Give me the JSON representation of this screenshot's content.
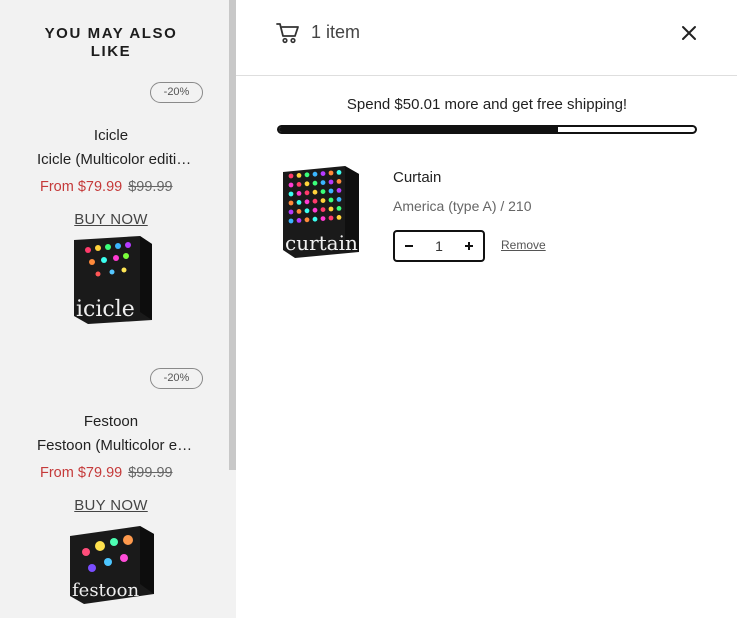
{
  "recommendations": {
    "title": "YOU MAY ALSO LIKE",
    "items": [
      {
        "badge": "-20%",
        "name": "Icicle",
        "variant": "Icicle (Multicolor edition)",
        "price_sale": "From $79.99",
        "price_old": "$99.99",
        "cta": "BUY NOW",
        "image_word": "icicle"
      },
      {
        "badge": "-20%",
        "name": "Festoon",
        "variant": "Festoon (Multicolor edition)",
        "price_sale": "From $79.99",
        "price_old": "$99.99",
        "cta": "BUY NOW",
        "image_word": "festoon"
      }
    ]
  },
  "cart": {
    "header_icon": "cart-icon",
    "item_count": "1 item",
    "close_icon": "close-icon",
    "shipping_message": "Spend $50.01 more and get free shipping!",
    "shipping_progress": 0.67,
    "line_items": [
      {
        "title": "Curtain",
        "variant": "America (type A) / 210",
        "quantity": "1",
        "remove_label": "Remove",
        "image_word": "curtain"
      }
    ]
  },
  "colors": {
    "sale_price": "#c53a3a",
    "panel_bg": "#f2f2f2",
    "accent": "#111111"
  }
}
